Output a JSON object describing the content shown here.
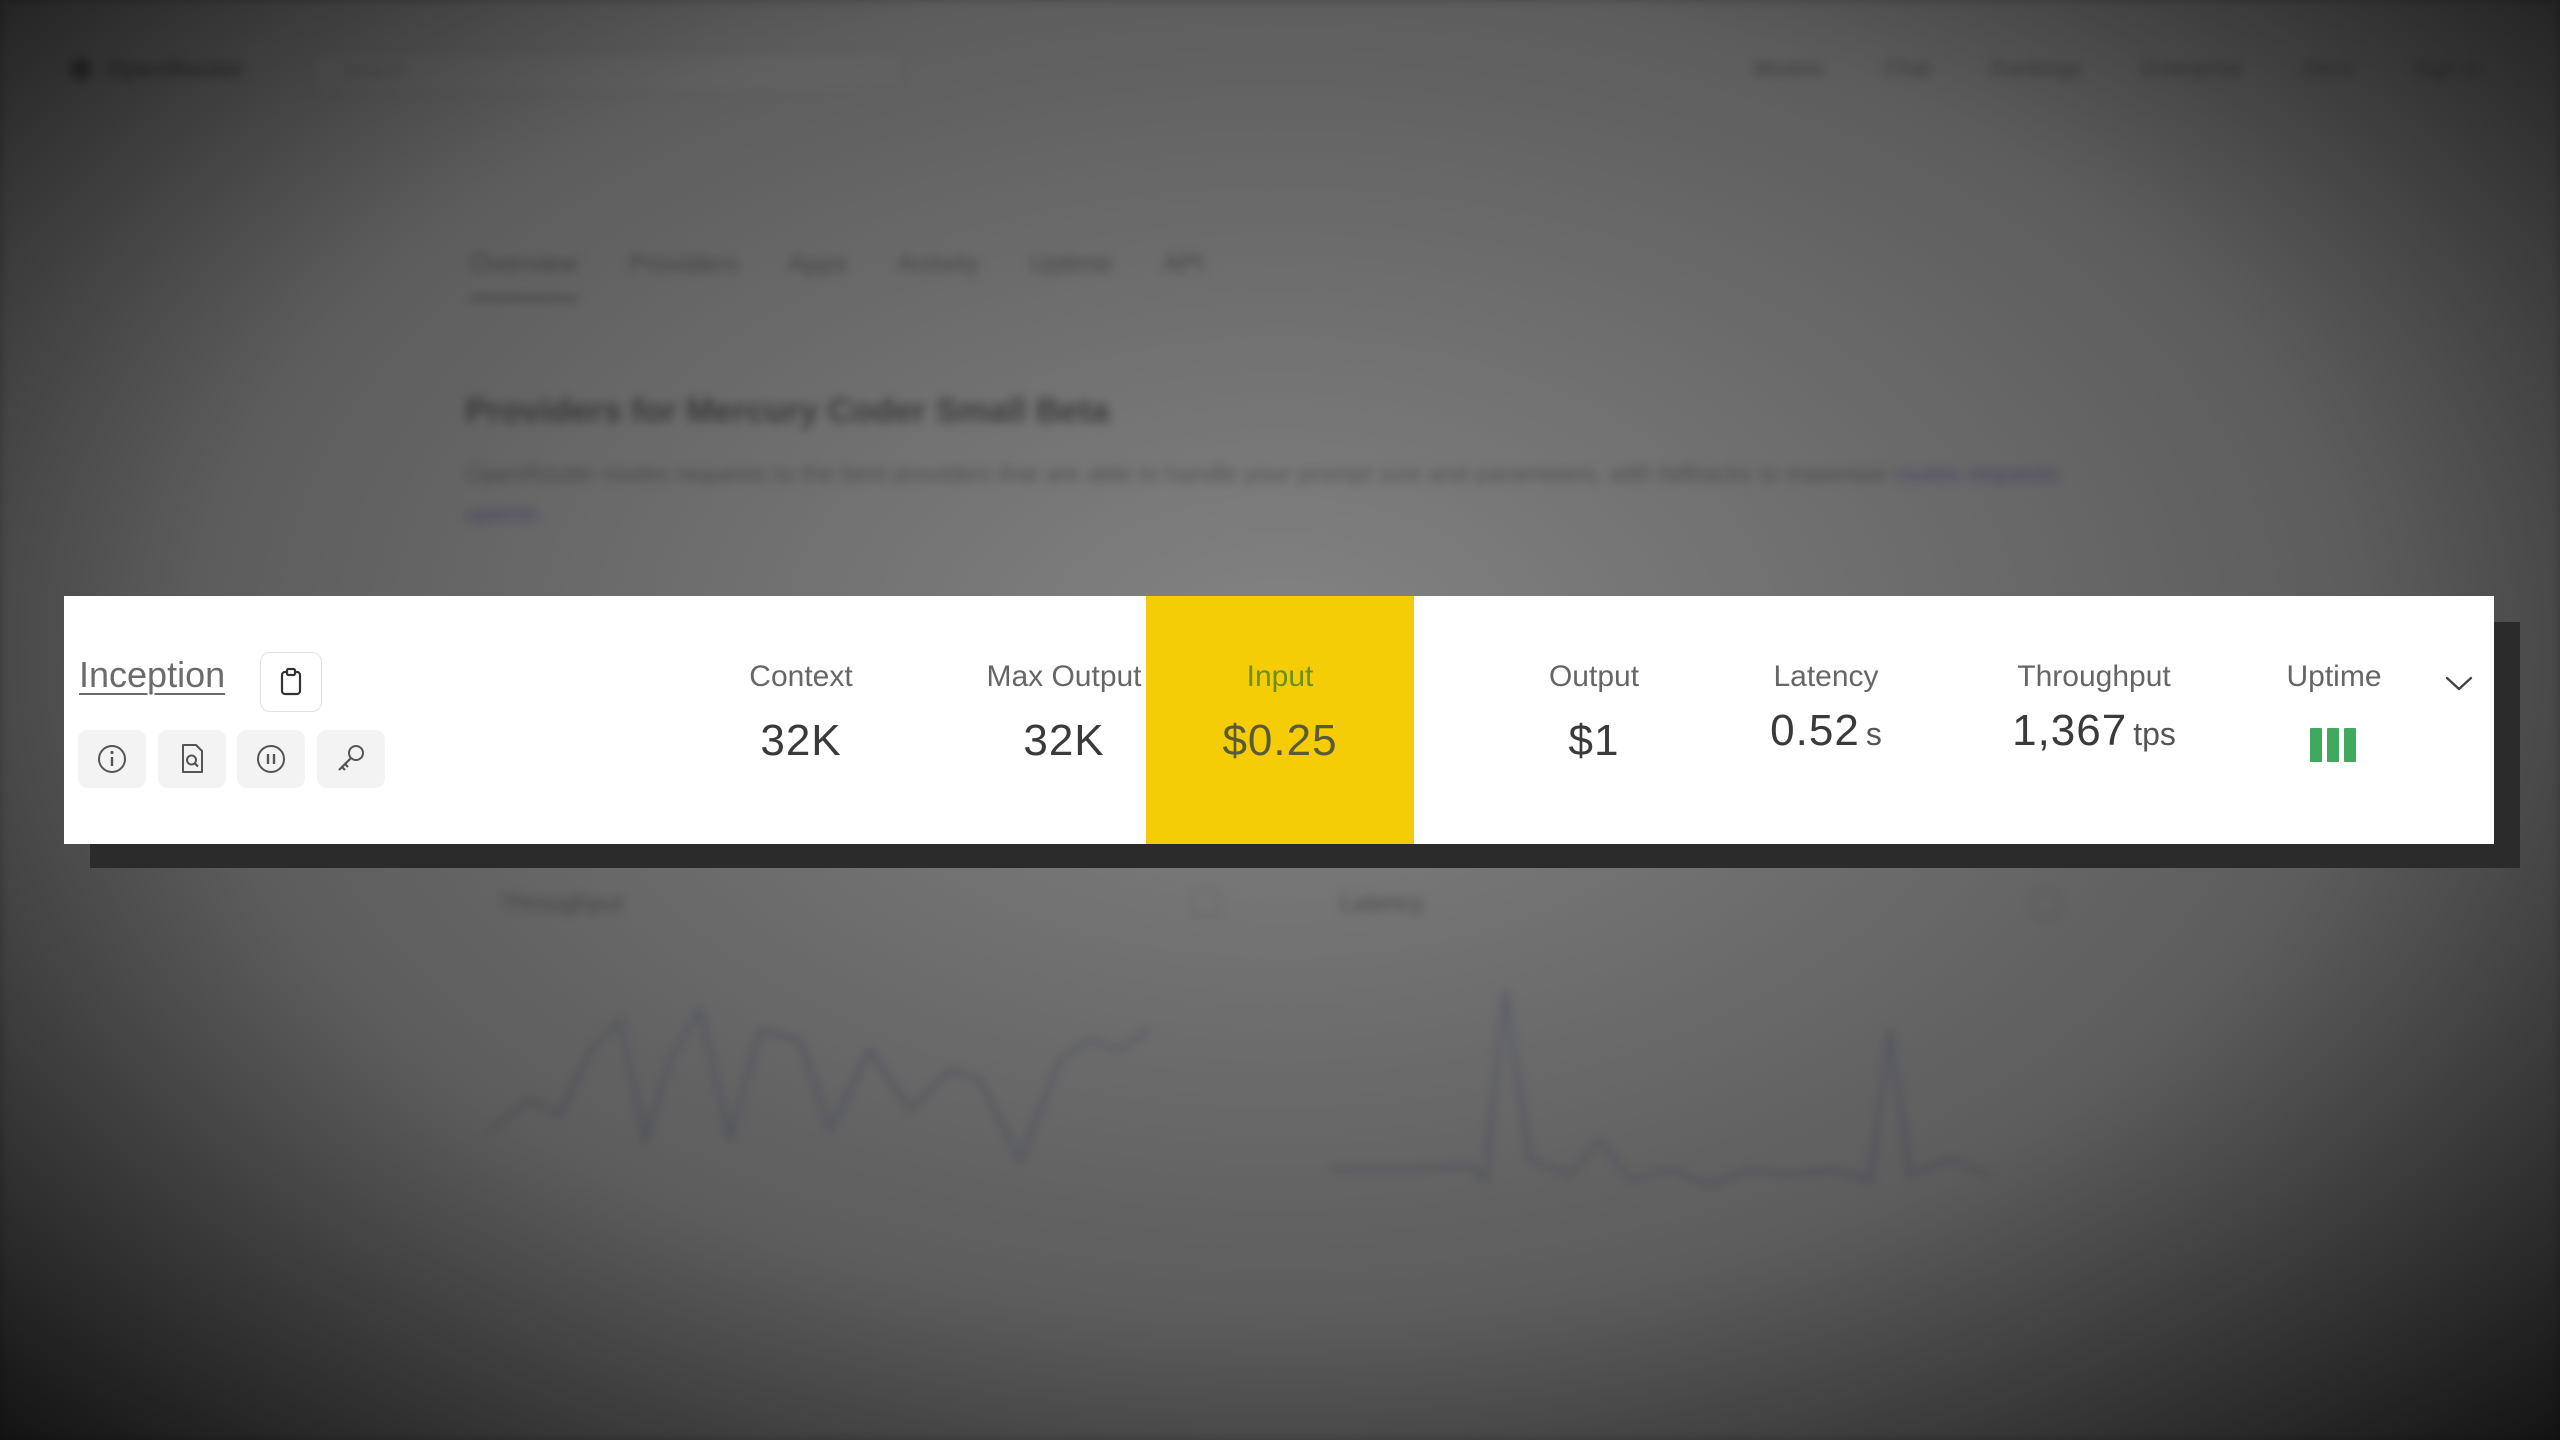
{
  "background": {
    "top_nav": {
      "logo": "OpenRouter",
      "search_placeholder": "Search",
      "links": [
        "Models",
        "Chat",
        "Rankings",
        "Enterprise",
        "Docs",
        "Sign in"
      ]
    },
    "tabs": [
      "Overview",
      "Providers",
      "Apps",
      "Activity",
      "Uptime",
      "API"
    ],
    "heading": "Providers for Mercury Coder Small Beta",
    "paragraph": "OpenRouter routes requests to the best providers that are able to handle your prompt size and parameters, with fallbacks to maximize",
    "paragraph_link": "routes requests",
    "paragraph_link2": "uptime.",
    "charts": [
      {
        "title": "Throughput"
      },
      {
        "title": "Latency"
      }
    ]
  },
  "provider": {
    "name": "Inception",
    "icons": [
      "info-icon",
      "document-search-icon",
      "pause-icon",
      "key-icon"
    ]
  },
  "metrics": {
    "context": {
      "label": "Context",
      "value": "32K"
    },
    "max_output": {
      "label": "Max Output",
      "value": "32K"
    },
    "input": {
      "label": "Input",
      "value": "$0.25"
    },
    "output": {
      "label": "Output",
      "value": "$1"
    },
    "latency": {
      "label": "Latency",
      "value": "0.52",
      "unit": "s"
    },
    "throughput": {
      "label": "Throughput",
      "value": "1,367",
      "unit": "tps"
    },
    "uptime": {
      "label": "Uptime",
      "bars": 3
    }
  },
  "colors": {
    "highlight": "#f5cd06",
    "uptime_green": "#3faa5e",
    "chart_line": "#9aa4d8"
  }
}
